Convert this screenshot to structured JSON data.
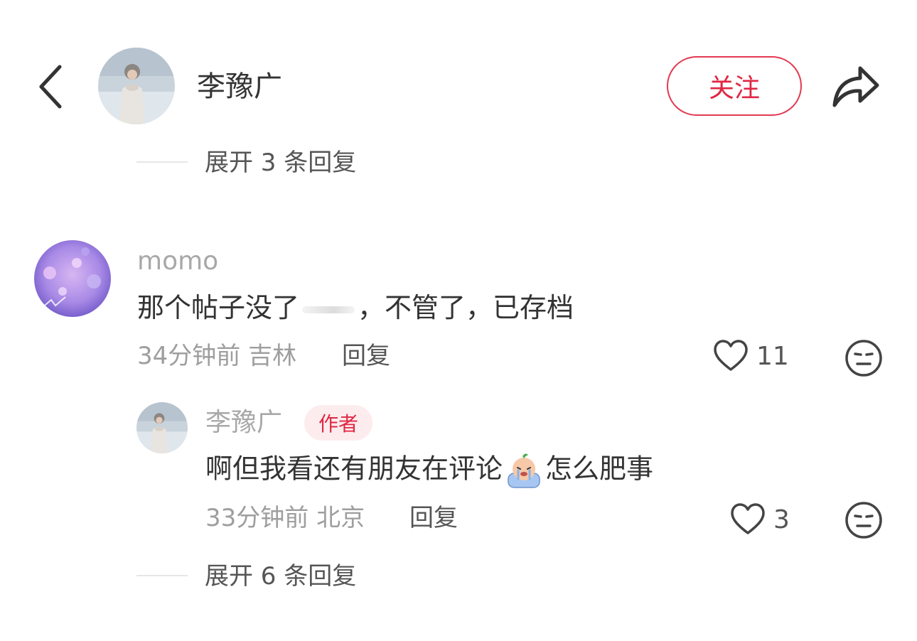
{
  "header": {
    "author_name": "李豫广",
    "follow_label": "关注"
  },
  "expand_top": {
    "label": "展开 3 条回复"
  },
  "comment": {
    "username": "momo",
    "text_before": "那个帖子没了",
    "text_after": "，不管了，已存档",
    "time": "34分钟前",
    "location": "吉林",
    "reply_label": "回复",
    "likes": "11"
  },
  "reply": {
    "username": "李豫广",
    "badge": "作者",
    "text_before": "啊但我看还有朋友在评论",
    "text_after": "怎么肥事",
    "time": "33分钟前",
    "location": "北京",
    "reply_label": "回复",
    "likes": "3"
  },
  "expand_bottom": {
    "label": "展开 6 条回复"
  },
  "colors": {
    "accent": "#e02743",
    "badge_bg": "#fdecee",
    "meta": "#9e9e9e"
  }
}
